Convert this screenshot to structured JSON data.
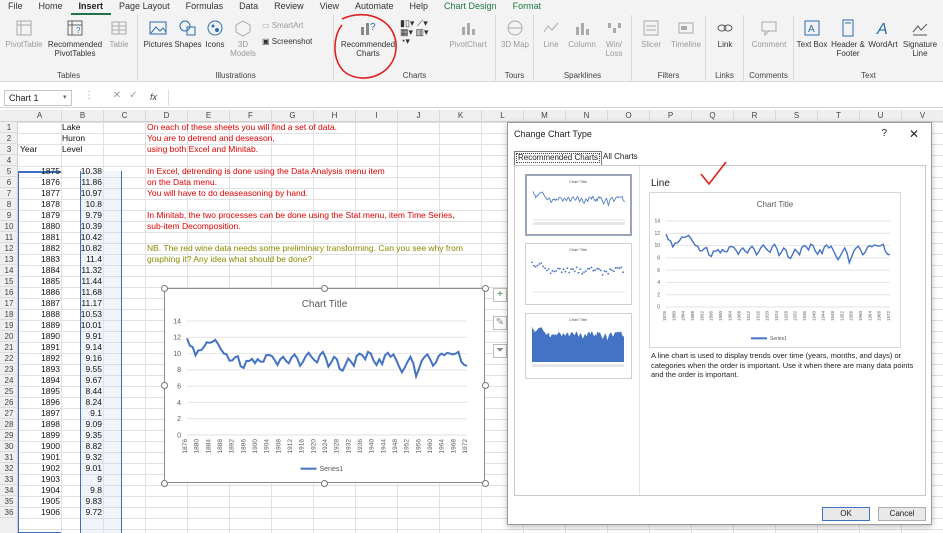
{
  "ribbon_tabs": [
    {
      "label": "File",
      "active": false
    },
    {
      "label": "Home",
      "active": false
    },
    {
      "label": "Insert",
      "active": true
    },
    {
      "label": "Page Layout",
      "active": false
    },
    {
      "label": "Formulas",
      "active": false
    },
    {
      "label": "Data",
      "active": false
    },
    {
      "label": "Review",
      "active": false
    },
    {
      "label": "View",
      "active": false
    },
    {
      "label": "Automate",
      "active": false
    },
    {
      "label": "Help",
      "active": false
    },
    {
      "label": "Chart Design",
      "active": false,
      "contextual": true
    },
    {
      "label": "Format",
      "active": false,
      "contextual": true
    }
  ],
  "ribbon": {
    "tables": {
      "label": "Tables",
      "pivottable": "PivotTable",
      "recommended_pivot": "Recommended PivotTables",
      "table": "Table"
    },
    "illustrations": {
      "label": "Illustrations",
      "pictures": "Pictures",
      "shapes": "Shapes",
      "icons": "Icons",
      "models": "3D Models",
      "smartart": "SmartArt",
      "screenshot": "Screenshot"
    },
    "charts": {
      "label": "Charts",
      "recommended": "Recommended Charts",
      "pivotchart": "PivotChart"
    },
    "tours": {
      "label": "Tours",
      "map": "3D Map"
    },
    "sparklines": {
      "label": "Sparklines",
      "line": "Line",
      "column": "Column",
      "winloss": "Win/ Loss"
    },
    "filters": {
      "label": "Filters",
      "slicer": "Slicer",
      "timeline": "Timeline"
    },
    "links": {
      "label": "Links",
      "link": "Link"
    },
    "comments": {
      "label": "Comments",
      "comment": "Comment"
    },
    "text": {
      "label": "Text",
      "textbox": "Text Box",
      "headerfooter": "Header & Footer",
      "wordart": "WordArt",
      "signature": "Signature Line"
    }
  },
  "formula_bar": {
    "name_box": "Chart 1",
    "fx": "fx",
    "value": ""
  },
  "columns": [
    "A",
    "B",
    "C",
    "D",
    "E",
    "F",
    "G",
    "H",
    "I",
    "J",
    "K",
    "L",
    "M",
    "N",
    "O",
    "P",
    "Q",
    "R",
    "S",
    "T",
    "U",
    "V"
  ],
  "rows": [
    "1",
    "2",
    "3",
    "4",
    "5",
    "6",
    "7",
    "8",
    "9",
    "10",
    "11",
    "12",
    "13",
    "14",
    "15",
    "16",
    "17",
    "18",
    "19",
    "20",
    "21",
    "22",
    "23",
    "24",
    "25",
    "26",
    "27",
    "28",
    "29",
    "30",
    "31",
    "32",
    "33",
    "34",
    "35",
    "36"
  ],
  "sheet": {
    "header": {
      "b1": "Lake",
      "b2": "Huron",
      "a3": "Year",
      "b3": "Level"
    },
    "years": [
      "1875",
      "1876",
      "1877",
      "1878",
      "1879",
      "1880",
      "1881",
      "1882",
      "1883",
      "1884",
      "1885",
      "1886",
      "1887",
      "1888",
      "1889",
      "1890",
      "1891",
      "1892",
      "1893",
      "1894",
      "1895",
      "1896",
      "1897",
      "1898",
      "1899",
      "1900",
      "1901",
      "1902",
      "1903",
      "1904",
      "1905",
      "1906"
    ],
    "levels": [
      "10.38",
      "11.86",
      "10.97",
      "10.8",
      "9.79",
      "10.39",
      "10.42",
      "10.82",
      "11.4",
      "11.32",
      "11.44",
      "11.68",
      "11.17",
      "10.53",
      "10.01",
      "9.91",
      "9.14",
      "9.16",
      "9.55",
      "9.67",
      "8.44",
      "8.24",
      "9.1",
      "9.09",
      "9.35",
      "8.82",
      "9.32",
      "9.01",
      "9",
      "9.8",
      "9.83",
      "9.72"
    ],
    "notes_red": [
      "On each of these sheets you will find a set of data.",
      "You are to detrend and deseason,",
      "using both Excel and Minitab.",
      "",
      "In Excel, detrending is done using the Data Analysis menu item",
      "on the Data menu.",
      "You will have to do deaseasoning by hand.",
      "",
      "In Minitab, the two processes can be done using the Stat menu, item Time Series,",
      "sub-item Decomposition."
    ],
    "notes_olive": [
      "NB.  The red wine data needs some preliminary transforming.  Can you see why from",
      "graphing it?  Any idea what should be done?"
    ]
  },
  "chart": {
    "title": "Chart Title",
    "legend": "Series1",
    "y_ticks": [
      "0",
      "2",
      "4",
      "6",
      "8",
      "10",
      "12",
      "14"
    ],
    "x_ticks": [
      "1876",
      "1880",
      "1884",
      "1888",
      "1892",
      "1896",
      "1900",
      "1904",
      "1908",
      "1912",
      "1916",
      "1920",
      "1924",
      "1928",
      "1932",
      "1936",
      "1940",
      "1944",
      "1948",
      "1952",
      "1956",
      "1960",
      "1964",
      "1968",
      "1972"
    ]
  },
  "chart_data": {
    "type": "line",
    "title": "Chart Title",
    "series": [
      {
        "name": "Series1",
        "values": [
          11.86,
          10.97,
          10.8,
          9.79,
          10.39,
          10.42,
          10.82,
          11.4,
          11.32,
          11.44,
          11.68,
          11.17,
          10.53,
          10.01,
          9.91,
          9.14,
          9.16,
          9.55,
          9.67,
          8.44,
          8.24,
          9.1,
          9.09,
          9.35,
          8.82,
          9.32,
          9.01,
          9,
          9.8,
          9.83,
          9.72,
          9.2,
          8.6,
          9.3,
          9.6,
          9.1,
          8.8,
          9.5,
          9.9,
          9.4,
          8.5,
          9.0,
          9.7,
          10.1,
          9.6,
          9.2,
          8.9,
          9.8,
          10.2,
          9.5,
          8.4,
          8.9,
          9.6,
          9.3,
          8.1,
          7.9,
          8.6,
          9.4,
          9.0,
          8.5,
          9.7,
          10.0,
          9.8,
          9.3,
          10.2,
          10.0,
          9.1,
          8.6,
          9.3,
          8.7,
          9.8,
          10.1,
          9.6,
          9.9,
          9.2,
          8.4,
          7.7,
          8.3,
          9.0,
          9.6,
          8.8,
          7.2,
          8.1,
          9.1,
          9.6,
          9.9,
          9.3,
          8.5,
          8.9,
          9.7,
          10.0,
          9.8,
          10.1,
          10.0,
          9.9,
          10.0,
          10.2,
          9.0,
          8.6,
          8.5
        ]
      }
    ],
    "ylim": [
      0,
      14
    ],
    "xlabel": "",
    "ylabel": ""
  },
  "dialog": {
    "title": "Change Chart Type",
    "help": "?",
    "close": "✕",
    "tab_recommended": "Recommended Charts",
    "tab_all": "All Charts",
    "chart_type": "Line",
    "preview_title": "Chart Title",
    "preview_legend": "Series1",
    "thumb_title": "Chart Title",
    "description": "A line chart is used to display trends over time (years, months, and days) or categories when the order is important. Use it when there are many data points and the order is important.",
    "ok": "OK",
    "cancel": "Cancel"
  },
  "colors": {
    "accent": "#217346",
    "data_line": "#4472c4",
    "annotation": "#e02020",
    "notes_red": "#e00000",
    "notes_olive": "#8a8a00"
  }
}
